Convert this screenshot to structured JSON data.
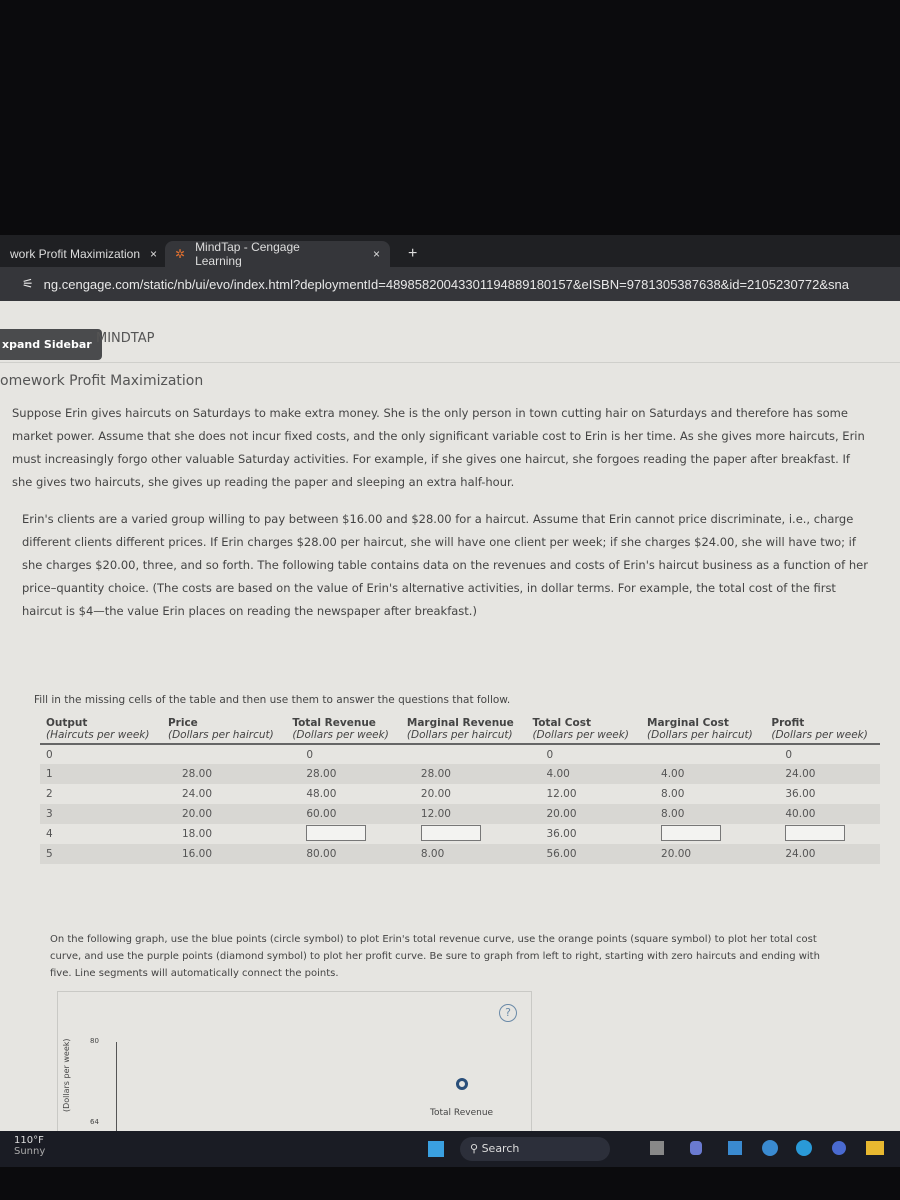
{
  "browser": {
    "tabs": [
      {
        "label": "work Profit Maximization"
      },
      {
        "label": "MindTap - Cengage Learning"
      }
    ],
    "close": "×",
    "new_tab": "+",
    "url": "ng.cengage.com/static/nb/ui/evo/index.html?deploymentId=48985820043301194889180157&eISBN=9781305387638&id=2105230772&sna"
  },
  "header": {
    "expand_sidebar": "xpand Sidebar",
    "brand": "MINDTAP",
    "title": "omework Profit Maximization"
  },
  "intro": {
    "p1": "Suppose Erin gives haircuts on Saturdays to make extra money. She is the only person in town cutting hair on Saturdays and therefore has some market power. Assume that she does not incur fixed costs, and the only significant variable cost to Erin is her time. As she gives more haircuts, Erin must increasingly forgo other valuable Saturday activities. For example, if she gives one haircut, she forgoes reading the paper after breakfast. If she gives two haircuts, she gives up reading the paper and sleeping an extra half-hour.",
    "p2": "Erin's clients are a varied group willing to pay between $16.00 and $28.00 for a haircut. Assume that Erin cannot price discriminate, i.e., charge different clients different prices. If Erin charges $28.00 per haircut, she will have one client per week; if she charges $24.00, she will have two; if she charges $20.00, three, and so forth. The following table contains data on the revenues and costs of Erin's haircut business as a function of her price–quantity choice. (The costs are based on the value of Erin's alternative activities, in dollar terms. For example, the total cost of the first haircut is $4—the value Erin places on reading the newspaper after breakfast.)",
    "instruction": "Fill in the missing cells of the table and then use them to answer the questions that follow."
  },
  "table": {
    "headers": [
      {
        "t": "Output",
        "u": "(Haircuts per week)"
      },
      {
        "t": "Price",
        "u": "(Dollars per haircut)"
      },
      {
        "t": "Total Revenue",
        "u": "(Dollars per week)"
      },
      {
        "t": "Marginal Revenue",
        "u": "(Dollars per haircut)"
      },
      {
        "t": "Total Cost",
        "u": "(Dollars per week)"
      },
      {
        "t": "Marginal Cost",
        "u": "(Dollars per haircut)"
      },
      {
        "t": "Profit",
        "u": "(Dollars per week)"
      }
    ],
    "rows": [
      [
        "0",
        "",
        "0",
        "",
        "0",
        "",
        "0"
      ],
      [
        "1",
        "28.00",
        "28.00",
        "28.00",
        "4.00",
        "4.00",
        "24.00"
      ],
      [
        "2",
        "24.00",
        "48.00",
        "20.00",
        "12.00",
        "8.00",
        "36.00"
      ],
      [
        "3",
        "20.00",
        "60.00",
        "12.00",
        "20.00",
        "8.00",
        "40.00"
      ],
      [
        "4",
        "18.00",
        "",
        "",
        "36.00",
        "",
        ""
      ],
      [
        "5",
        "16.00",
        "80.00",
        "8.00",
        "56.00",
        "20.00",
        "24.00"
      ]
    ]
  },
  "graph": {
    "instructions": "On the following graph, use the blue points (circle symbol) to plot Erin's total revenue curve, use the orange points (square symbol) to plot her total cost curve, and use the purple points (diamond symbol) to plot her profit curve. Be sure to graph from left to right, starting with zero haircuts and ending with five. Line segments will automatically connect the points.",
    "help": "?",
    "ylabel": "(Dollars per week)",
    "ticks": [
      "80",
      "64"
    ],
    "legend": "Total Revenue"
  },
  "taskbar": {
    "weather_temp": "110°F",
    "weather_cond": "Sunny",
    "search": "Search"
  }
}
